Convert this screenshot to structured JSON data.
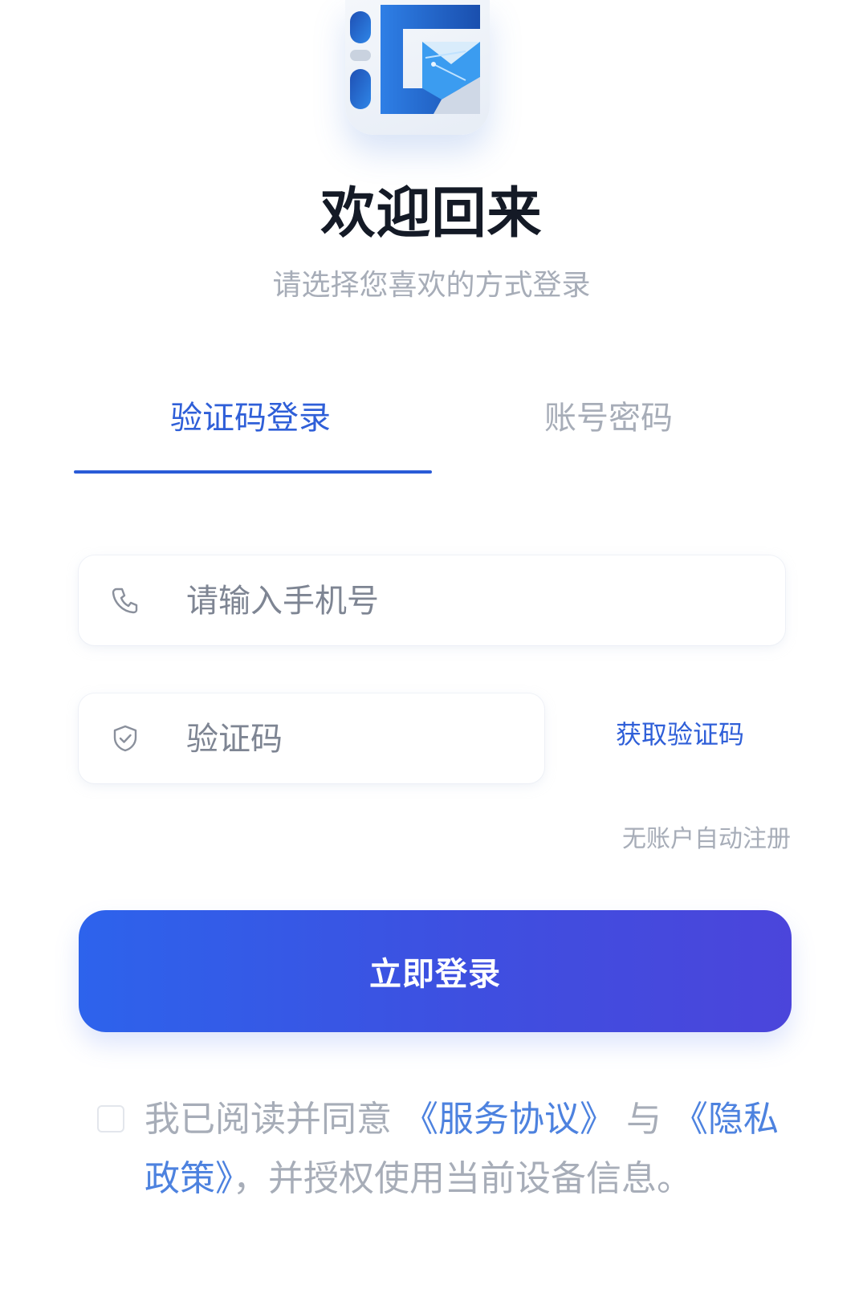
{
  "title": "欢迎回来",
  "subtitle": "请选择您喜欢的方式登录",
  "tabs": [
    {
      "label": "验证码登录",
      "active": true
    },
    {
      "label": "账号密码",
      "active": false
    }
  ],
  "phone_input": {
    "placeholder": "请输入手机号",
    "value": ""
  },
  "code_input": {
    "placeholder": "验证码",
    "value": ""
  },
  "get_code_label": "获取验证码",
  "auto_register_note": "无账户自动注册",
  "login_button_label": "立即登录",
  "agreement": {
    "checked": false,
    "prefix": "我已阅读并同意 ",
    "service_link": "《服务协议》",
    "middle": " 与 ",
    "privacy_link": "《隐私政策》",
    "suffix": "，并授权使用当前设备信息。"
  },
  "icons": {
    "phone": "phone-icon",
    "code": "shield-check-icon",
    "logo": "app-logo"
  },
  "colors": {
    "accent": "#2f5fd8",
    "title": "#141a26",
    "muted": "#a7adb8",
    "button_start": "#2d63ec",
    "button_end": "#4b45db"
  }
}
